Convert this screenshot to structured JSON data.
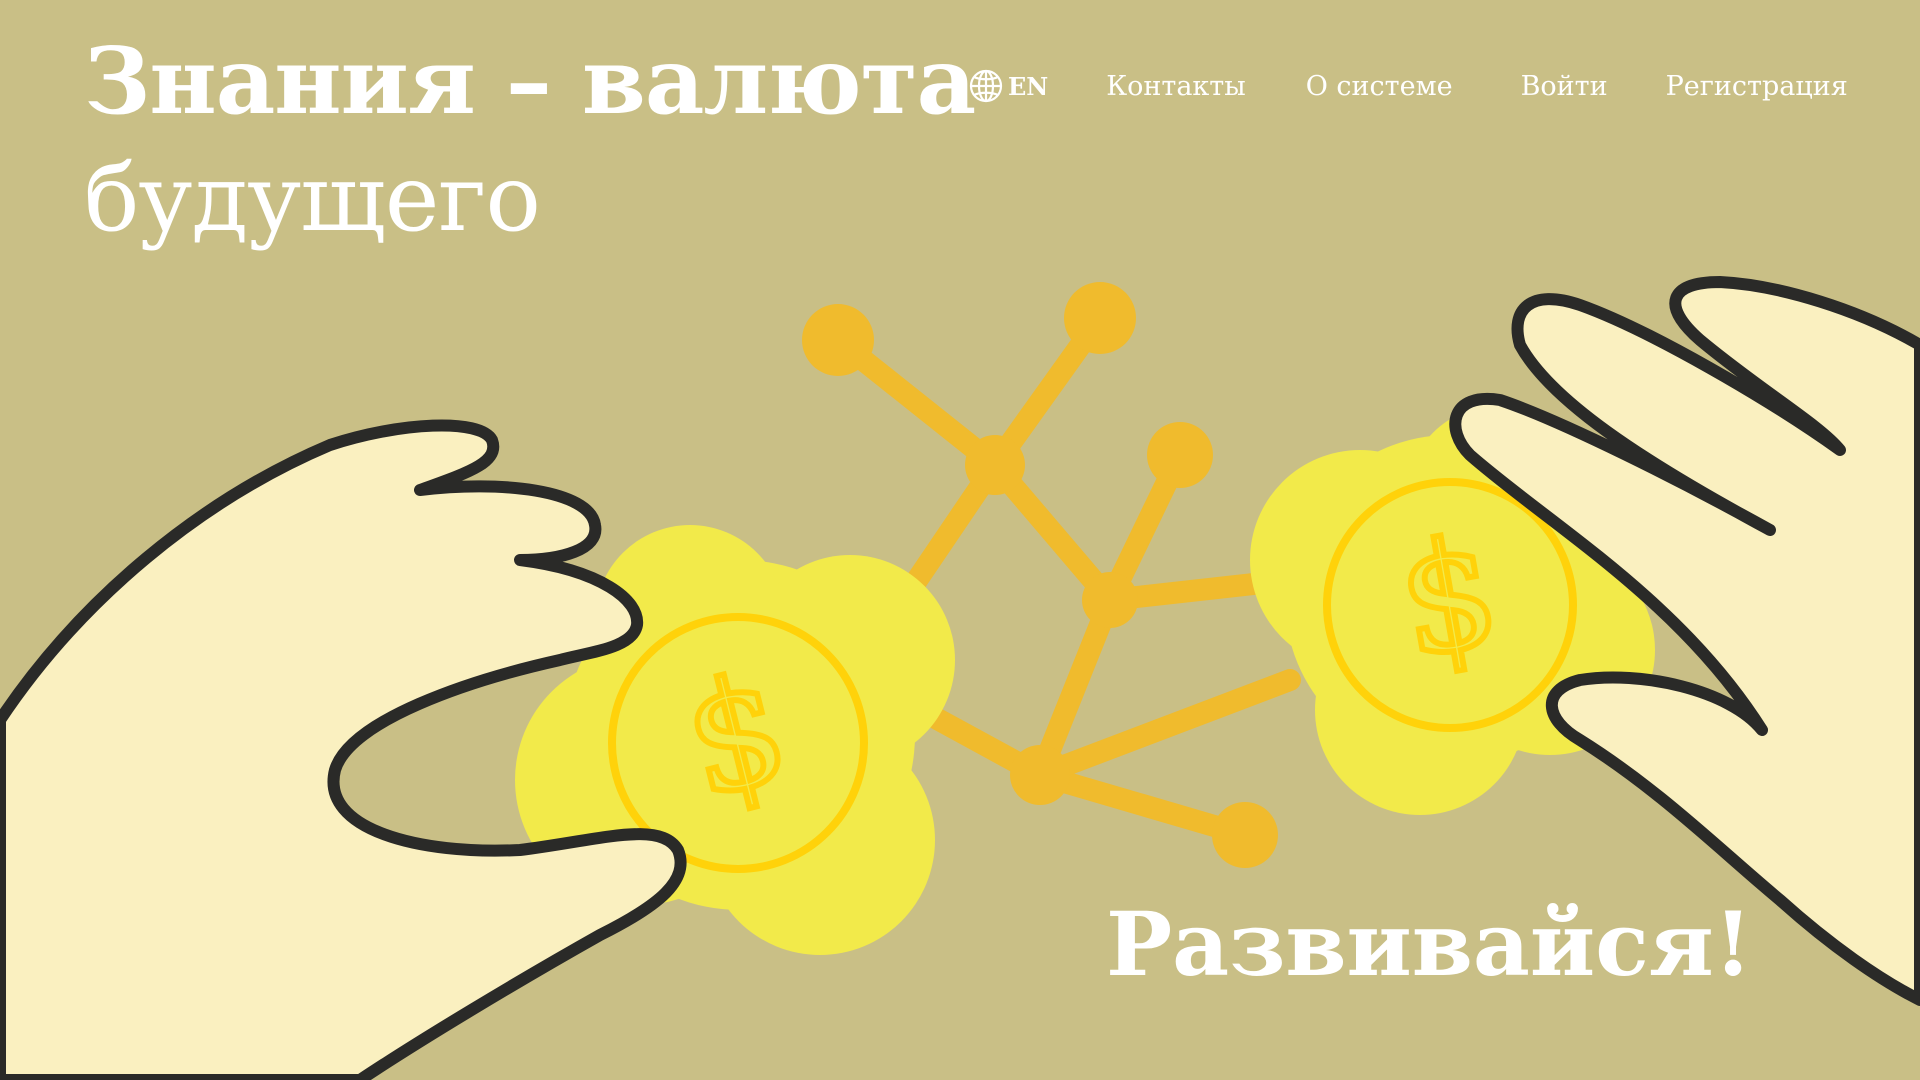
{
  "colors": {
    "background": "#c9bf86",
    "text": "#ffffff",
    "hand_fill": "#faf0c0",
    "outline": "#2a2a28",
    "coin_glow": "#f2ea4a",
    "coin": "#ffd20a",
    "network": "#f0bb2d"
  },
  "hero": {
    "line1": "Знания – валюта",
    "line2": "будущего"
  },
  "nav": {
    "language": {
      "icon": "globe-icon",
      "label": "EN"
    },
    "contacts": "Контакты",
    "about": "О системе",
    "login": "Войти",
    "register": "Регистрация"
  },
  "slogan": "Развивайся!",
  "illustration": {
    "coin_symbol": "$",
    "icons": [
      "left-hand-icon",
      "right-hand-icon",
      "dollar-coin-icon",
      "network-graph-icon"
    ]
  }
}
